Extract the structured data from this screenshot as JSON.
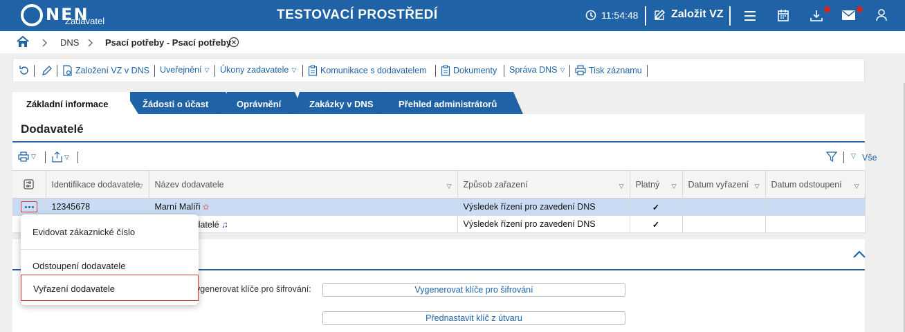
{
  "header": {
    "logo_text": "NEN",
    "logo_sub": "Zadavatel",
    "env_title": "TESTOVACÍ PROSTŘEDÍ",
    "clock": "11:54:48",
    "create_label": "Založit VZ",
    "icons": [
      "clock-icon",
      "pen-icon",
      "menu-icon",
      "calendar-icon",
      "download-icon",
      "mail-icon",
      "user-icon"
    ]
  },
  "breadcrumb": {
    "items": [
      "DNS",
      "Psací potřeby - Psací potřeby"
    ]
  },
  "toolbar": {
    "items": [
      "Založení VZ v DNS",
      "Uveřejnění",
      "Úkony zadavatele",
      "Komunikace s dodavatelem",
      "Dokumenty",
      "Správa DNS",
      "Tisk záznamu"
    ]
  },
  "tabs": [
    "Základní informace",
    "Žádosti o účast",
    "Oprávnění",
    "Zakázky v DNS",
    "Přehled administrátorů"
  ],
  "panel": {
    "title": "Dodavatelé",
    "filter_label": "Vše"
  },
  "table": {
    "columns": [
      "Identifikace dodavatele",
      "Název dodavatele",
      "Způsob zařazení",
      "Platný",
      "Datum vyřazení",
      "Datum odstoupení"
    ],
    "rows": [
      {
        "id": "12345678",
        "name": "Marní Malíři",
        "zpusob": "Výsledek řízení pro zavedení DNS",
        "platny": "✓",
        "vyrazeni": "",
        "odstoupeni": ""
      },
      {
        "id": "",
        "name": "datelé",
        "zpusob": "Výsledek řízení pro zavedení DNS",
        "platny": "✓",
        "vyrazeni": "",
        "odstoupeni": ""
      }
    ]
  },
  "context_menu": {
    "items": [
      "Evidovat zákaznické číslo",
      "Odstoupení dodavatele",
      "Vyřazení dodavatele"
    ]
  },
  "keys": {
    "label": "ygenerovat klíče pro šifrování:",
    "generate_button": "Vygenerovat klíče pro šifrování",
    "preset_button": "Přednastavit klíč z útvaru"
  },
  "colors": {
    "brand": "#1f63a6",
    "selected_row": "#c9dcf4",
    "alert": "#d8241f",
    "check": "#2e9e3e"
  }
}
